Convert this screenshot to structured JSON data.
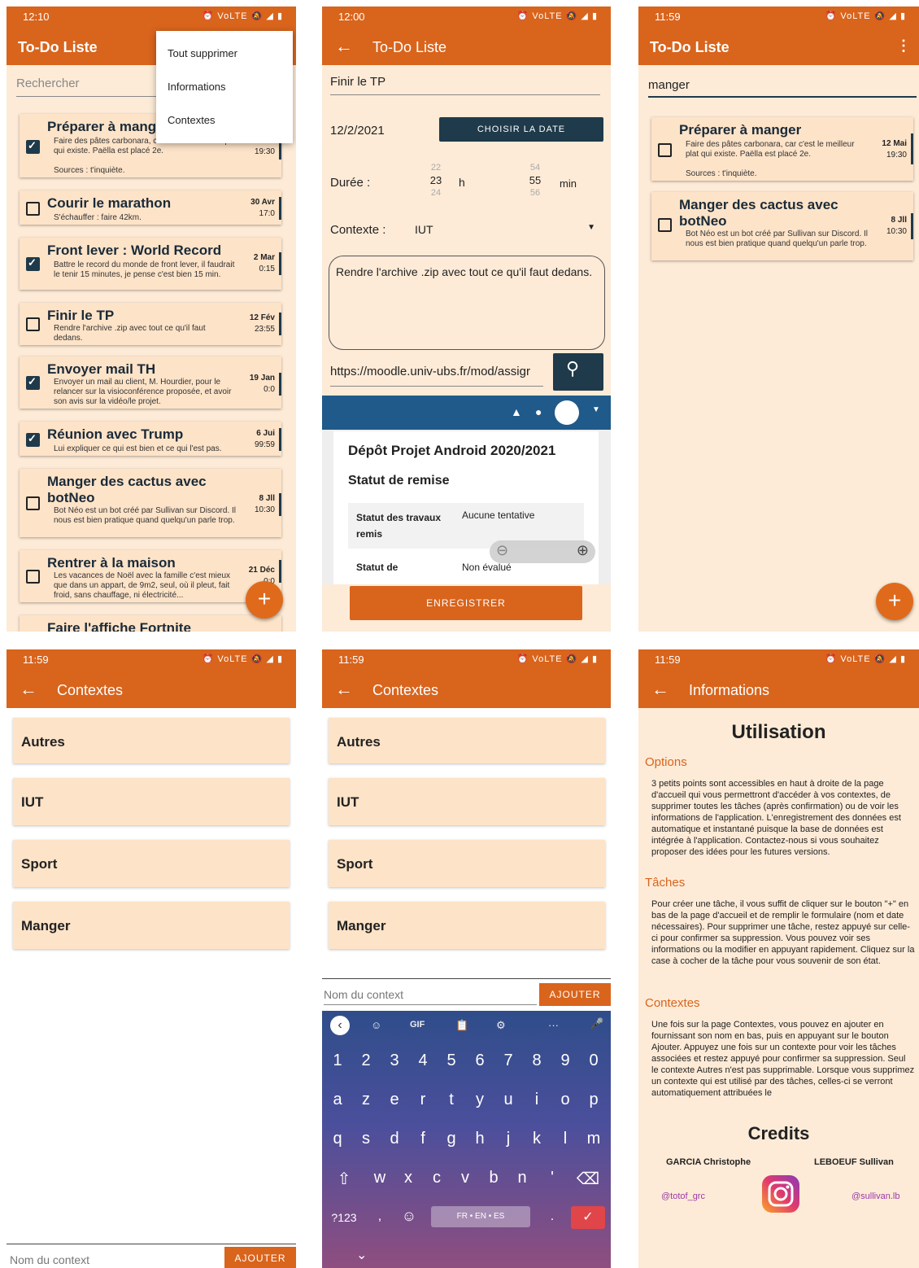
{
  "screens": {
    "list": {
      "status_time": "12:10",
      "status_icons": "⏰ VoLTE 🔕 ◢ ▮",
      "app_title": "To-Do Liste",
      "search_placeholder": "Rechercher",
      "menu": [
        "Tout supprimer",
        "Informations",
        "Contextes"
      ],
      "tasks": [
        {
          "title": "Préparer à mange",
          "desc": "Faire des pâtes carbonara, car c'est le meilleur plat qui existe. Paëlla est placé 2e.",
          "src": "Sources : t'inquiète.",
          "date1": "12 Mai",
          "date2": "19:30",
          "checked": true
        },
        {
          "title": "Courir le marathon",
          "desc": "S'échauffer : faire 42km.",
          "date1": "30 Avr",
          "date2": "17:0",
          "checked": false
        },
        {
          "title": "Front lever : World Record",
          "desc": "Battre le record du monde de front lever, il faudrait le tenir 15 minutes, je pense c'est bien 15 min.",
          "date1": "2 Mar",
          "date2": "0:15",
          "checked": true
        },
        {
          "title": "Finir le TP",
          "desc": "Rendre l'archive .zip avec tout ce qu'il faut dedans.",
          "date1": "12 Fév",
          "date2": "23:55",
          "checked": false
        },
        {
          "title": "Envoyer mail TH",
          "desc": "Envoyer un mail au client, M. Hourdier, pour le relancer sur la visioconférence proposée, et avoir son avis sur la vidéo/le projet.",
          "date1": "19 Jan",
          "date2": "0:0",
          "checked": true
        },
        {
          "title": "Réunion avec Trump",
          "desc": "Lui expliquer ce qui est bien et ce qui l'est pas.",
          "date1": "6 Jui",
          "date2": "99:59",
          "checked": true
        },
        {
          "title": "Manger des cactus avec botNeo",
          "desc": "Bot Néo est un bot créé par Sullivan sur Discord. Il nous est bien pratique quand quelqu'un parle trop.",
          "date1": "8 Jll",
          "date2": "10:30",
          "checked": false
        },
        {
          "title": "Rentrer à la maison",
          "desc": "Les vacances de Noël avec la famille c'est mieux que dans un appart, de 9m2, seul, où il pleut, fait froid, sans chauffage, ni électricité...",
          "date1": "21 Déc",
          "date2": "0:0",
          "checked": false
        },
        {
          "title": "Faire l'affiche Fortnite"
        }
      ],
      "fab": "+"
    },
    "edit": {
      "status_time": "12:00",
      "app_title": "To-Do Liste",
      "task_name": "Finir le TP",
      "date_value": "12/2/2021",
      "date_button": "CHOISIR LA DATE",
      "duration_label": "Durée :",
      "hours": [
        "22",
        "23",
        "24"
      ],
      "hours_unit": "h",
      "minutes": [
        "54",
        "55",
        "56"
      ],
      "minutes_unit": "min",
      "context_label": "Contexte :",
      "context_value": "IUT",
      "description": "Rendre l'archive .zip avec tout ce qu'il faut dedans.",
      "url": "https://moodle.univ-ubs.fr/mod/assigr",
      "web_heading": "Dépôt Projet Android 2020/2021",
      "web_subheading": "Statut de remise",
      "web_rows": [
        {
          "k": "Statut des travaux remis",
          "v": "Aucune tentative"
        },
        {
          "k": "Statut de",
          "v": "Non évalué"
        }
      ],
      "save_button": "ENREGISTRER"
    },
    "search": {
      "status_time": "11:59",
      "app_title": "To-Do Liste",
      "search_value": "manger",
      "tasks": [
        {
          "title": "Préparer à manger",
          "desc": "Faire des pâtes carbonara, car c'est le meilleur plat qui existe. Paëlla est placé 2e.",
          "src": "Sources : t'inquiète.",
          "date1": "12 Mai",
          "date2": "19:30"
        },
        {
          "title": "Manger des cactus avec botNeo",
          "desc": "Bot Néo est un bot créé par Sullivan sur Discord. Il nous est bien pratique quand quelqu'un parle trop.",
          "date1": "8 Jll",
          "date2": "10:30"
        }
      ],
      "fab": "+"
    },
    "contexts": {
      "status_time": "11:59",
      "app_title": "Contextes",
      "items": [
        "Autres",
        "IUT",
        "Sport",
        "Manger"
      ],
      "input_placeholder": "Nom du context",
      "add_button": "AJOUTER"
    },
    "contexts_kb": {
      "status_time": "11:59",
      "app_title": "Contextes",
      "items": [
        "Autres",
        "IUT",
        "Sport",
        "Manger"
      ],
      "input_placeholder": "Nom du context",
      "add_button": "AJOUTER",
      "keyboard": {
        "tools": [
          "‹",
          "☺",
          "GIF",
          "📋",
          "⚙",
          "···",
          "🎤"
        ],
        "row_numbers": [
          "1",
          "2",
          "3",
          "4",
          "5",
          "6",
          "7",
          "8",
          "9",
          "0"
        ],
        "row1": [
          "a",
          "z",
          "e",
          "r",
          "t",
          "y",
          "u",
          "i",
          "o",
          "p"
        ],
        "row2": [
          "q",
          "s",
          "d",
          "f",
          "g",
          "h",
          "j",
          "k",
          "l",
          "m"
        ],
        "row3": [
          "⇧",
          "w",
          "x",
          "c",
          "v",
          "b",
          "n",
          "'",
          "⌫"
        ],
        "sym": "?123",
        "comma": ",",
        "emoji": "☺",
        "space": "FR • EN • ES",
        "period": ".",
        "enter": "✓",
        "hide": "⌄"
      }
    },
    "info": {
      "status_time": "11:59",
      "app_title": "Informations",
      "heading": "Utilisation",
      "sections": [
        {
          "h": "Options",
          "p": "3 petits points sont accessibles en haut à droite de la page d'accueil qui vous permettront d'accéder à vos contextes, de supprimer toutes les tâches (après confirmation) ou de voir les informations de l'application. L'enregistrement des données est automatique et instantané puisque la base de données est intégrée à l'application. Contactez-nous si vous souhaitez proposer des idées pour les futures versions."
        },
        {
          "h": "Tâches",
          "p": "Pour créer une tâche, il vous suffit de cliquer sur le bouton \"+\" en bas de la page d'accueil et de remplir le formulaire (nom et date nécessaires). Pour supprimer une tâche, restez appuyé sur celle-ci pour confirmer sa suppression. Vous pouvez voir ses informations ou la modifier en appuyant rapidement. Cliquez sur la case à cocher de la tâche pour vous souvenir de son état."
        },
        {
          "h": "Contextes",
          "p": "Une fois sur la page Contextes, vous pouvez en ajouter en fournissant son nom en bas, puis en appuyant sur le bouton Ajouter. Appuyez une fois sur un contexte pour voir les tâches associées et restez appuyé pour confirmer sa suppression. Seul le contexte Autres n'est pas supprimable. Lorsque vous supprimez un contexte qui est utilisé par des tâches, celles-ci se verront automatiquement attribuées le"
        }
      ],
      "credits_heading": "Credits",
      "author1": "GARCIA Christophe",
      "author2": "LEBOEUF Sullivan",
      "handle1": "@totof_grc",
      "handle2": "@sullivan.lb"
    }
  }
}
